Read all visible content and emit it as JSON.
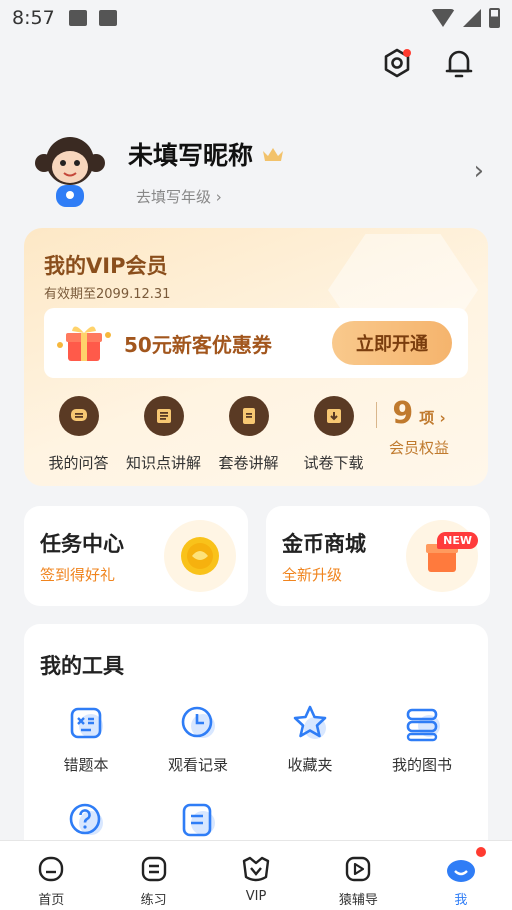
{
  "status_bar": {
    "time": "8:57"
  },
  "profile": {
    "nickname": "未填写昵称",
    "grade_hint": "去填写年级 ›"
  },
  "vip": {
    "title": "我的VIP会员",
    "valid_until": "有效期至2099.12.31",
    "coupon_text": "50元新客优惠券",
    "open_button": "立即开通",
    "features": [
      "我的问答",
      "知识点讲解",
      "套卷讲解",
      "试卷下载"
    ],
    "rights_count": "9",
    "rights_unit": "项 ›",
    "rights_label": "会员权益"
  },
  "task_center": {
    "title": "任务中心",
    "subtitle": "签到得好礼"
  },
  "coin_mall": {
    "title": "金币商城",
    "subtitle": "全新升级",
    "badge": "NEW"
  },
  "tools": {
    "title": "我的工具",
    "items": [
      "错题本",
      "观看记录",
      "收藏夹",
      "我的图书"
    ]
  },
  "tabbar": {
    "items": [
      "首页",
      "练习",
      "VIP",
      "猿辅导",
      "我"
    ],
    "active": "我"
  },
  "colors": {
    "accent_blue": "#2f7df6",
    "vip_brown": "#8a4e1c",
    "orange": "#f0841e",
    "badge_red": "#ff3b30"
  }
}
